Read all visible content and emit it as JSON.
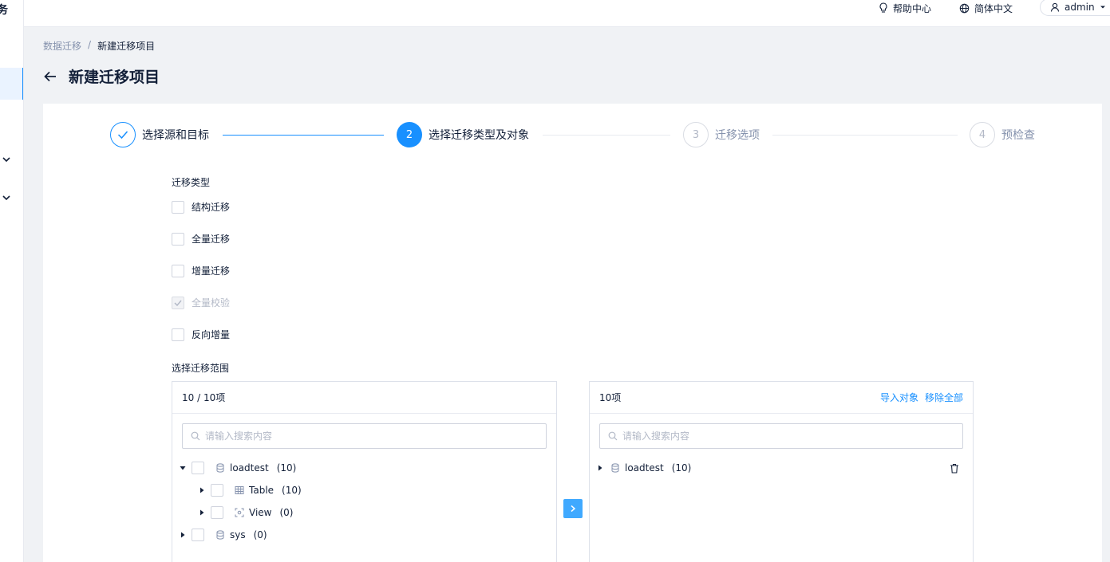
{
  "sidebar": {
    "brand_fragment": "务"
  },
  "header": {
    "help": "帮助中心",
    "language": "简体中文",
    "user": "admin"
  },
  "breadcrumb": {
    "parent": "数据迁移",
    "separator": "/",
    "current": "新建迁移项目"
  },
  "page": {
    "title": "新建迁移项目"
  },
  "steps": [
    {
      "index": "1",
      "label": "选择源和目标",
      "state": "done"
    },
    {
      "index": "2",
      "label": "选择迁移类型及对象",
      "state": "current"
    },
    {
      "index": "3",
      "label": "迁移选项",
      "state": "wait"
    },
    {
      "index": "4",
      "label": "预检查",
      "state": "wait"
    }
  ],
  "migration_type": {
    "label": "迁移类型",
    "options": [
      {
        "label": "结构迁移",
        "checked": false,
        "disabled": false
      },
      {
        "label": "全量迁移",
        "checked": false,
        "disabled": false
      },
      {
        "label": "增量迁移",
        "checked": false,
        "disabled": false
      },
      {
        "label": "全量校验",
        "checked": true,
        "disabled": true
      },
      {
        "label": "反向增量",
        "checked": false,
        "disabled": false
      }
    ]
  },
  "scope": {
    "label": "选择迁移范围"
  },
  "left_panel": {
    "count": "10 / 10项",
    "search_placeholder": "请输入搜索内容",
    "tree": [
      {
        "name": "loadtest",
        "count": "(10)",
        "icon": "database-icon"
      },
      {
        "name": "Table",
        "count": "(10)",
        "icon": "table-icon"
      },
      {
        "name": "View",
        "count": "(0)",
        "icon": "view-icon"
      },
      {
        "name": "sys",
        "count": "(0)",
        "icon": "database-icon"
      }
    ]
  },
  "right_panel": {
    "count": "10项",
    "import_link": "导入对象",
    "remove_all_link": "移除全部",
    "search_placeholder": "请输入搜索内容",
    "tree": [
      {
        "name": "loadtest",
        "count": "(10)",
        "icon": "database-icon"
      }
    ]
  },
  "colors": {
    "primary": "#1890ff",
    "text": "#132039",
    "muted": "#8592ad",
    "border": "#dde1ea"
  }
}
